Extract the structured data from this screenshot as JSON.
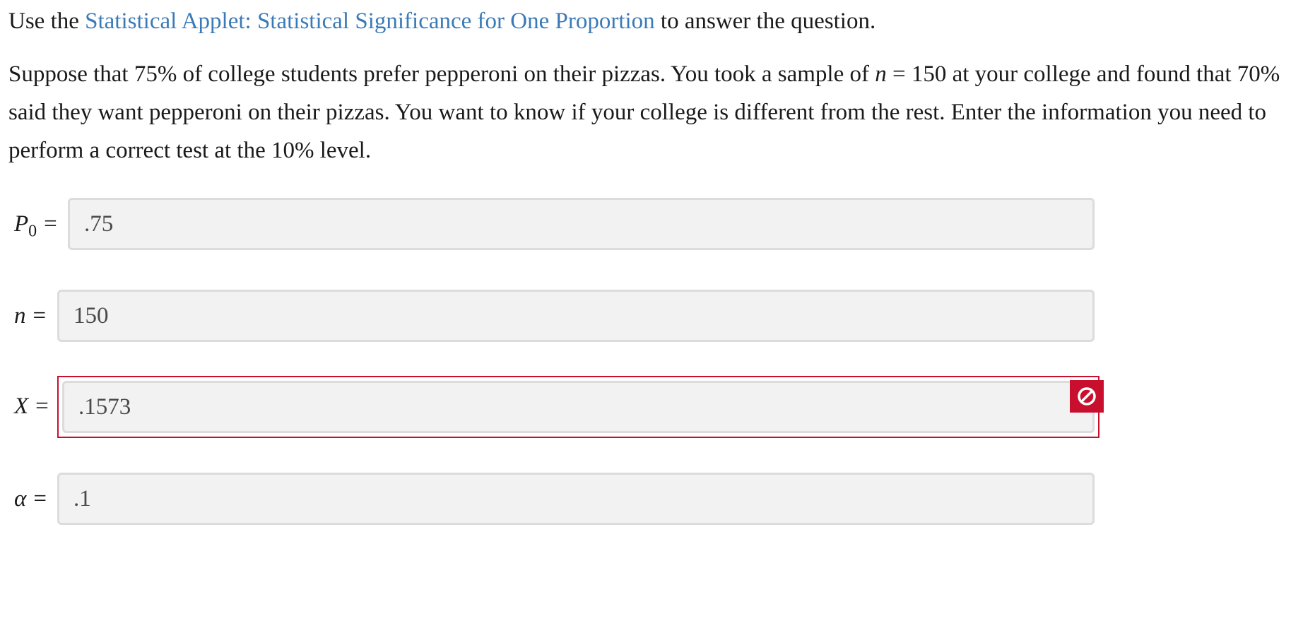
{
  "intro": {
    "prefix": "Use the ",
    "link_text": "Statistical Applet: Statistical Significance for One Proportion",
    "suffix": " to answer the question."
  },
  "question": {
    "part1": "Suppose that 75% of college students prefer pepperoni on their pizzas. You took a sample of ",
    "n_var": "n",
    "part2": " = 150 at your college and found that 70% said they want pepperoni on their pizzas. You want to know if your college is different from the rest. Enter the information you need to perform a correct test at the 10% level."
  },
  "fields": {
    "p0": {
      "label_var": "P",
      "label_sub": "0",
      "equals": "=",
      "value": ".75"
    },
    "n": {
      "label_var": "n",
      "equals": "=",
      "value": "150"
    },
    "x": {
      "label_var": "X",
      "equals": "=",
      "value": ".1573",
      "status": "incorrect"
    },
    "alpha": {
      "label_var": "α",
      "equals": "=",
      "value": ".1"
    }
  },
  "colors": {
    "link": "#3a7ab8",
    "error": "#c8102e",
    "field_bg": "#f2f2f2",
    "field_border": "#dcdcdc"
  },
  "icons": {
    "error": "prohibited-icon"
  }
}
